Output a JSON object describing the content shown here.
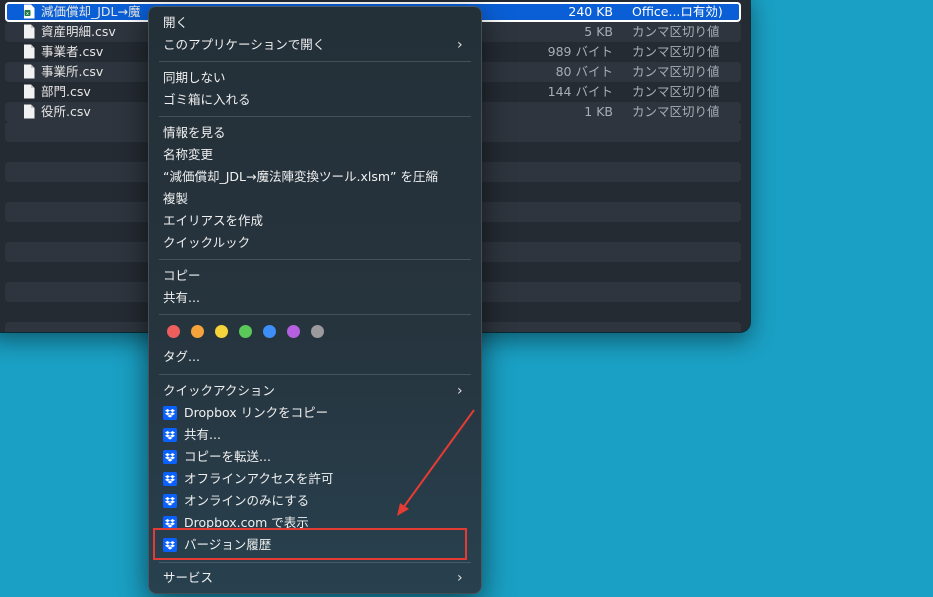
{
  "finder": {
    "files": [
      {
        "name": "減価償却_JDL→魔",
        "size": "240 KB",
        "kind": "Office...ロ有効)",
        "selected": true,
        "icon": "excel-file-icon"
      },
      {
        "name": "資産明細.csv",
        "size": "5 KB",
        "kind": "カンマ区切り値",
        "icon": "document-icon"
      },
      {
        "name": "事業者.csv",
        "size": "989 バイト",
        "kind": "カンマ区切り値",
        "icon": "document-icon"
      },
      {
        "name": "事業所.csv",
        "size": "80 バイト",
        "kind": "カンマ区切り値",
        "icon": "document-icon"
      },
      {
        "name": "部門.csv",
        "size": "144 バイト",
        "kind": "カンマ区切り値",
        "icon": "document-icon"
      },
      {
        "name": "役所.csv",
        "size": "1 KB",
        "kind": "カンマ区切り値",
        "icon": "document-icon"
      }
    ]
  },
  "menu": {
    "open": "開く",
    "open_with": "このアプリケーションで開く",
    "no_sync": "同期しない",
    "trash": "ゴミ箱に入れる",
    "get_info": "情報を見る",
    "rename": "名称変更",
    "compress": "“減価償却_JDL→魔法陣変換ツール.xlsm” を圧縮",
    "duplicate": "複製",
    "make_alias": "エイリアスを作成",
    "quick_look": "クイックルック",
    "copy": "コピー",
    "share": "共有...",
    "tags_label": "タグ...",
    "tag_colors": [
      "#ec5f5d",
      "#f5a33c",
      "#f5d33b",
      "#5bc85a",
      "#3d8ef7",
      "#b560e0",
      "#9b9b9e"
    ],
    "quick_actions": "クイックアクション",
    "dropbox": {
      "copy_link": "Dropbox リンクをコピー",
      "share": "共有...",
      "send_copy": "コピーを転送...",
      "offline": "オフラインアクセスを許可",
      "online_only": "オンラインのみにする",
      "view_on_web": "Dropbox.com で表示",
      "version_history": "バージョン履歴"
    },
    "services": "サービス"
  },
  "annotation": {
    "color": "#e43b35"
  }
}
